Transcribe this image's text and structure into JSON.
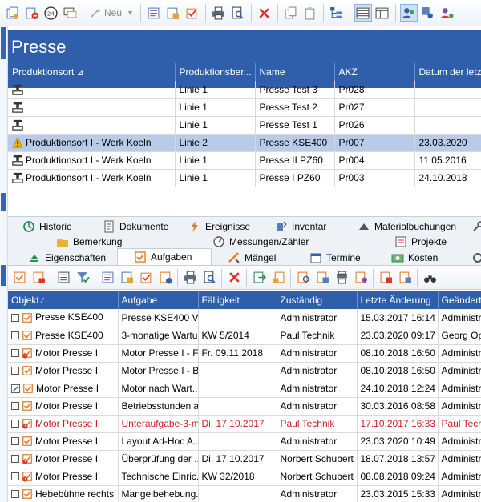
{
  "toolbar": {
    "new_label": "Neu",
    "icons": [
      "copy-icon",
      "remove-icon",
      "clock-24-icon",
      "chat-icon",
      "wand-icon",
      "task-list-icon",
      "task-add-icon",
      "task-check-icon",
      "print-icon",
      "print-preview-icon",
      "delete-icon",
      "duplicate-icon",
      "paste-icon",
      "tree-view-icon",
      "list-view-icon",
      "detail-view-icon",
      "users-icon",
      "group-icon",
      "user-settings-icon"
    ]
  },
  "page": {
    "title": "Presse"
  },
  "machines_table": {
    "columns": [
      "Produktionsort",
      "Produktionsber...",
      "Name",
      "AKZ",
      "Datum der letz"
    ],
    "rows": [
      {
        "ort": "",
        "bereich": "Linie 1",
        "name": "Presse Test 3",
        "akz": "Pr028",
        "datum": "",
        "icon": "press-icon",
        "selected": false
      },
      {
        "ort": "",
        "bereich": "Linie 1",
        "name": "Presse Test 2",
        "akz": "Pr027",
        "datum": "",
        "icon": "press-icon",
        "selected": false
      },
      {
        "ort": "",
        "bereich": "Linie 1",
        "name": "Presse Test 1",
        "akz": "Pr026",
        "datum": "",
        "icon": "press-icon",
        "selected": false
      },
      {
        "ort": "Produktionsort I - Werk Koeln",
        "bereich": "Linie 2",
        "name": "Presse KSE400",
        "akz": "Pr007",
        "datum": "23.03.2020",
        "icon": "warning-icon",
        "selected": true
      },
      {
        "ort": "Produktionsort I - Werk Koeln",
        "bereich": "Linie 1",
        "name": "Presse II PZ60",
        "akz": "Pr004",
        "datum": "11.05.2016",
        "icon": "press-icon",
        "selected": false
      },
      {
        "ort": "Produktionsort I - Werk Koeln",
        "bereich": "Linie 1",
        "name": "Presse I PZ60",
        "akz": "Pr003",
        "datum": "24.10.2018",
        "icon": "press-icon",
        "selected": false
      }
    ]
  },
  "tabs": {
    "row1": [
      "Historie",
      "Dokumente",
      "Ereignisse",
      "Inventar",
      "Materialbuchungen"
    ],
    "row2": [
      "Bemerkung",
      "Messungen/Zähler",
      "Projekte"
    ],
    "row3": [
      "Eigenschaften",
      "Aufgaben",
      "Mängel",
      "Termine",
      "Kosten"
    ],
    "active": "Aufgaben"
  },
  "tasks_table": {
    "columns": [
      "Objekt",
      "Aufgabe",
      "Fälligkeit",
      "Zuständig",
      "Letzte Änderung",
      "Geändert"
    ],
    "rows": [
      {
        "objekt": "Presse KSE400",
        "aufgabe": "Presse KSE400 V...",
        "faellig": "",
        "zustaendig": "Administrator",
        "aenderung": "15.03.2017 16:14",
        "geaendert": "Administrat",
        "red": false,
        "edit": false
      },
      {
        "objekt": "Presse KSE400",
        "aufgabe": "3-monatige Wartu...",
        "faellig": "KW 5/2014",
        "zustaendig": "Paul Technik",
        "aenderung": "23.03.2020 09:17",
        "geaendert": "Georg Ope",
        "red": false,
        "edit": false
      },
      {
        "objekt": "Motor Presse I",
        "aufgabe": "Motor Presse I - F...",
        "faellig": "Fr. 09.11.2018",
        "zustaendig": "Administrator",
        "aenderung": "08.10.2018 16:50",
        "geaendert": "Administrat",
        "red": false,
        "edit": false
      },
      {
        "objekt": "Motor Presse I",
        "aufgabe": "Motor Presse I - B...",
        "faellig": "",
        "zustaendig": "Administrator",
        "aenderung": "08.10.2018 16:50",
        "geaendert": "Administrat",
        "red": false,
        "edit": false
      },
      {
        "objekt": "Motor Presse I",
        "aufgabe": "Motor nach Wart...",
        "faellig": "",
        "zustaendig": "Administrator",
        "aenderung": "24.10.2018 12:24",
        "geaendert": "Administrat",
        "red": false,
        "edit": true
      },
      {
        "objekt": "Motor Presse I",
        "aufgabe": "Betriebsstunden a...",
        "faellig": "",
        "zustaendig": "Administrator",
        "aenderung": "30.03.2016 08:58",
        "geaendert": "Administrat",
        "red": false,
        "edit": false
      },
      {
        "objekt": "Motor Presse I",
        "aufgabe": "Unteraufgabe-3-m...",
        "faellig": "Di. 17.10.2017",
        "zustaendig": "Paul Technik",
        "aenderung": "17.10.2017 16:33",
        "geaendert": "Paul Tech",
        "red": true,
        "edit": false
      },
      {
        "objekt": "Motor Presse I",
        "aufgabe": "Layout Ad-Hoc A...",
        "faellig": "",
        "zustaendig": "Administrator",
        "aenderung": "23.03.2020 10:49",
        "geaendert": "Administrat",
        "red": false,
        "edit": false
      },
      {
        "objekt": "Motor Presse I",
        "aufgabe": "Überprüfung der ...",
        "faellig": "Di. 17.10.2017",
        "zustaendig": "Norbert Schubert",
        "aenderung": "18.07.2018 13:57",
        "geaendert": "Administrat",
        "red": false,
        "edit": false
      },
      {
        "objekt": "Motor Presse I",
        "aufgabe": "Technische Einric...",
        "faellig": "KW 32/2018",
        "zustaendig": "Norbert Schubert",
        "aenderung": "08.08.2018 09:24",
        "geaendert": "Administrat",
        "red": false,
        "edit": false
      },
      {
        "objekt": "Hebebühne rechts",
        "aufgabe": "Mangelbehebung...",
        "faellig": "",
        "zustaendig": "Administrator",
        "aenderung": "23.03.2015 15:33",
        "geaendert": "Administrat",
        "red": false,
        "edit": false
      }
    ]
  }
}
